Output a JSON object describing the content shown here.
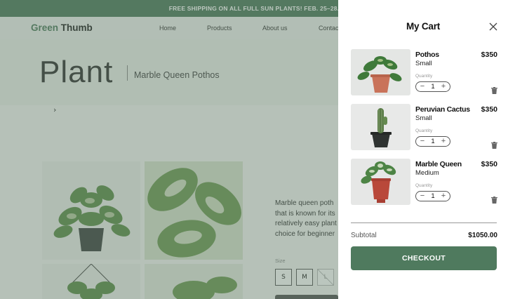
{
  "announcement": "FREE SHIPPING ON ALL FULL SUN PLANTS! FEB. 25–28.",
  "brand": {
    "part1": "Green",
    "part2": "Thumb"
  },
  "nav": {
    "links": [
      "Home",
      "Products",
      "About us",
      "Contact"
    ]
  },
  "hero": {
    "title": "Plant",
    "subtitle": "Marble Queen Pothos"
  },
  "product": {
    "description_lines": [
      "Marble queen poth",
      "that is known for its",
      "relatively easy plant",
      "choice for beginner"
    ],
    "size_label": "Size",
    "sizes": [
      "S",
      "M",
      "L"
    ]
  },
  "cart": {
    "title": "My Cart",
    "quantity_label": "Quantity",
    "items": [
      {
        "name": "Pothos",
        "variant": "Small",
        "price": "$350",
        "quantity": "1"
      },
      {
        "name": "Peruvian Cactus",
        "variant": "Small",
        "price": "$350",
        "quantity": "1"
      },
      {
        "name": "Marble Queen",
        "variant": "Medium",
        "price": "$350",
        "quantity": "1"
      }
    ],
    "subtotal_label": "Subtotal",
    "subtotal": "$1050.00",
    "checkout_label": "CHECKOUT"
  },
  "icons": {
    "close": "close-icon",
    "trash": "trash-icon",
    "minus": "minus-icon",
    "plus": "plus-icon",
    "chevron": "chevron-right-icon"
  },
  "colors": {
    "brand_green": "#4f7a5e",
    "background": "#f6f7f5",
    "drawer": "#ffffff"
  }
}
